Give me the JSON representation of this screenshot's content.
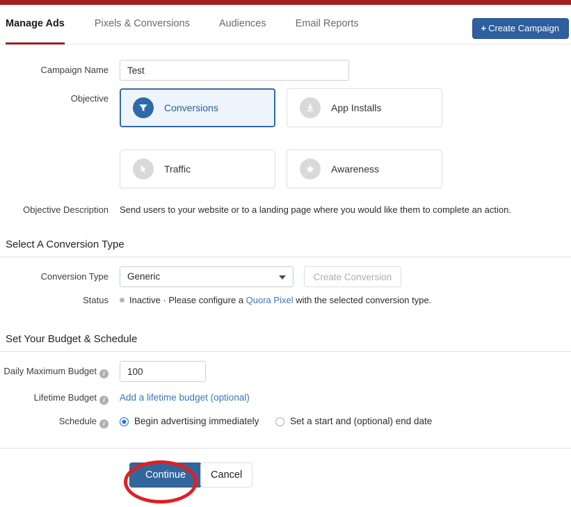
{
  "topbar": {
    "color": "#a41e22"
  },
  "nav": {
    "tabs": [
      {
        "label": "Manage Ads",
        "active": true
      },
      {
        "label": "Pixels & Conversions",
        "active": false
      },
      {
        "label": "Audiences",
        "active": false
      },
      {
        "label": "Email Reports",
        "active": false
      }
    ],
    "create_campaign": {
      "plus": "+",
      "label": "Create Campaign"
    }
  },
  "campaign": {
    "name_label": "Campaign Name",
    "name_value": "Test",
    "name_placeholder": "",
    "objective_label": "Objective",
    "objectives": [
      {
        "label": "Conversions",
        "icon": "funnel-icon",
        "selected": true
      },
      {
        "label": "App Installs",
        "icon": "download-icon",
        "selected": false
      },
      {
        "label": "Traffic",
        "icon": "cursor-icon",
        "selected": false
      },
      {
        "label": "Awareness",
        "icon": "star-icon",
        "selected": false
      }
    ],
    "description_label": "Objective Description",
    "description_text": "Send users to your website or to a landing page where you would like them to complete an action."
  },
  "conversion": {
    "section_title": "Select A Conversion Type",
    "type_label": "Conversion Type",
    "type_value": "Generic",
    "create_conversion_label": "Create Conversion",
    "status_label": "Status",
    "status_prefix": "Inactive · Please configure a ",
    "status_link": "Quora Pixel",
    "status_suffix": " with the selected conversion type.",
    "status_dot_color": "#b5b5b5"
  },
  "budget": {
    "section_title": "Set Your Budget & Schedule",
    "daily_label": "Daily Maximum Budget",
    "daily_value": "100",
    "daily_placeholder": "",
    "lifetime_label": "Lifetime Budget",
    "lifetime_link": "Add a lifetime budget (optional)",
    "schedule_label": "Schedule",
    "schedule_options": [
      {
        "label": "Begin advertising immediately",
        "checked": true
      },
      {
        "label": "Set a start and (optional) end date",
        "checked": false
      }
    ],
    "info_glyph": "i"
  },
  "footer": {
    "continue_label": "Continue",
    "cancel_label": "Cancel"
  },
  "annotation": {
    "shape": "ellipse",
    "color": "#e02020"
  }
}
